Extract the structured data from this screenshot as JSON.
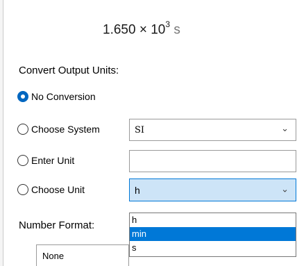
{
  "result": {
    "mantissa": "1.650",
    "times": "×",
    "base": "10",
    "exponent": "3",
    "unit": "s"
  },
  "convert": {
    "heading": "Convert Output Units:",
    "options": [
      {
        "label": "No Conversion",
        "checked": true
      },
      {
        "label": "Choose System",
        "checked": false
      },
      {
        "label": "Enter Unit",
        "checked": false
      },
      {
        "label": "Choose Unit",
        "checked": false
      }
    ],
    "system_value": "SI",
    "enter_unit_value": "",
    "unit_value": "h",
    "unit_options": [
      "h",
      "min",
      "s"
    ],
    "highlighted_option": "min"
  },
  "number_format": {
    "label": "Number Format:",
    "value": "None"
  },
  "icons": {
    "dropdown_arrow": "chevron-down-icon"
  },
  "colors": {
    "accent": "#0078d7",
    "selected_field": "#cde4f7"
  }
}
